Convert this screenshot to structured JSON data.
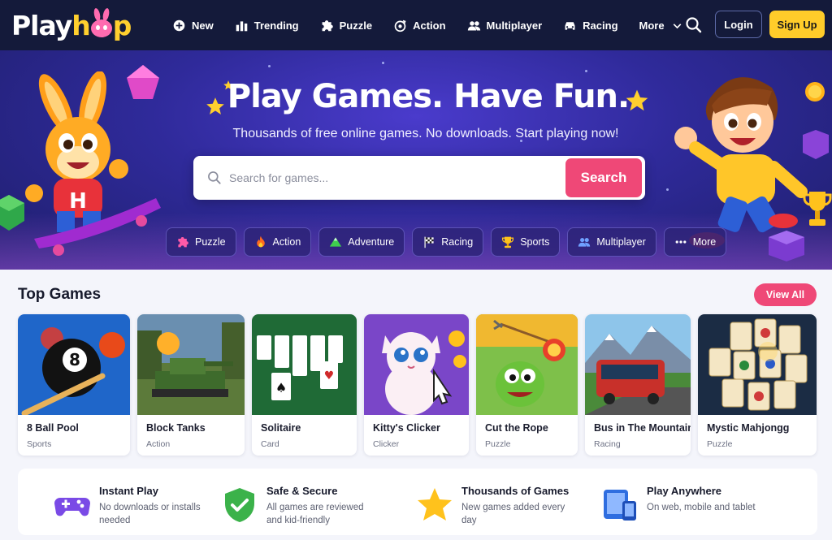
{
  "brand": {
    "logo_part1": "Play",
    "logo_part2": "h",
    "logo_part3": "p"
  },
  "nav": {
    "links": [
      {
        "label": "New",
        "icon": "plus-circle-icon"
      },
      {
        "label": "Trending",
        "icon": "bar-chart-icon"
      },
      {
        "label": "Puzzle",
        "icon": "puzzle-icon"
      },
      {
        "label": "Action",
        "icon": "action-icon"
      },
      {
        "label": "Multiplayer",
        "icon": "users-icon"
      },
      {
        "label": "Racing",
        "icon": "car-icon"
      },
      {
        "label": "More",
        "icon": "chevron-down-icon"
      }
    ],
    "login_label": "Login",
    "signup_label": "Sign Up"
  },
  "hero": {
    "title": "Play Games. Have Fun.",
    "subtitle": "Thousands of free online games. No downloads. Start playing now!",
    "search_placeholder": "Search for games...",
    "search_button": "Search",
    "categories": [
      {
        "label": "Puzzle",
        "icon": "puzzle-icon"
      },
      {
        "label": "Action",
        "icon": "fire-icon"
      },
      {
        "label": "Adventure",
        "icon": "mountain-icon"
      },
      {
        "label": "Racing",
        "icon": "checkered-flag-icon"
      },
      {
        "label": "Sports",
        "icon": "trophy-icon"
      },
      {
        "label": "Multiplayer",
        "icon": "users-icon"
      },
      {
        "label": "More",
        "icon": "dots-icon"
      }
    ]
  },
  "top_games": {
    "title": "Top Games",
    "view_all": "View All",
    "games": [
      {
        "title": "8 Ball Pool",
        "category": "Sports"
      },
      {
        "title": "Block Tanks",
        "category": "Action"
      },
      {
        "title": "Solitaire",
        "category": "Card"
      },
      {
        "title": "Kitty's Clicker",
        "category": "Clicker"
      },
      {
        "title": "Cut the Rope",
        "category": "Puzzle"
      },
      {
        "title": "Bus in The Mountains",
        "category": "Racing"
      },
      {
        "title": "Mystic Mahjongg",
        "category": "Puzzle"
      }
    ]
  },
  "features": [
    {
      "title": "Instant Play",
      "desc": "No downloads or installs needed",
      "icon": "gamepad-icon"
    },
    {
      "title": "Safe & Secure",
      "desc": "All games are reviewed and kid-friendly",
      "icon": "shield-check-icon"
    },
    {
      "title": "Thousands of Games",
      "desc": "New games added every day",
      "icon": "star-icon"
    },
    {
      "title": "Play Anywhere",
      "desc": "On web, mobile and tablet",
      "icon": "devices-icon"
    }
  ],
  "colors": {
    "nav_bg": "#141a3a",
    "accent_pink": "#ef4877",
    "accent_yellow": "#ffcc2a",
    "hero_purple": "#2f2a9a"
  }
}
